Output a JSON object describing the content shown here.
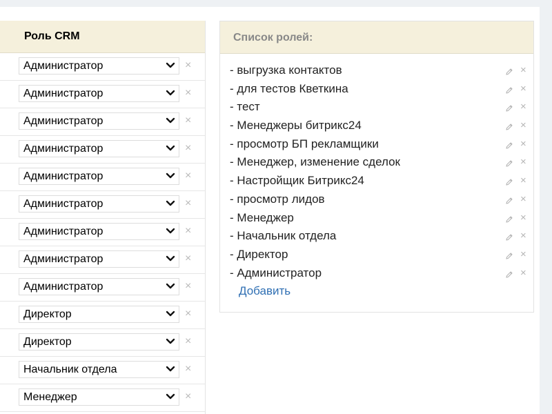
{
  "role_table": {
    "header": "Роль CRM",
    "rows": [
      {
        "role": "Администратор"
      },
      {
        "role": "Администратор"
      },
      {
        "role": "Администратор"
      },
      {
        "role": "Администратор"
      },
      {
        "role": "Администратор"
      },
      {
        "role": "Администратор"
      },
      {
        "role": "Администратор"
      },
      {
        "role": "Администратор"
      },
      {
        "role": "Администратор"
      },
      {
        "role": "Директор"
      },
      {
        "role": "Директор"
      },
      {
        "role": "Начальник отдела"
      },
      {
        "role": "Менеджер"
      }
    ],
    "remove_symbol": "×"
  },
  "roles_panel": {
    "title": "Список ролей:",
    "items": [
      {
        "label": "- выгрузка контактов"
      },
      {
        "label": "- для тестов Кветкина"
      },
      {
        "label": "- тест"
      },
      {
        "label": "- Менеджеры битрикс24"
      },
      {
        "label": "- просмотр БП рекламщики"
      },
      {
        "label": "- Менеджер, изменение сделок"
      },
      {
        "label": "- Настройщик Битрикс24"
      },
      {
        "label": "- просмотр лидов"
      },
      {
        "label": "- Менеджер"
      },
      {
        "label": "- Начальник отдела"
      },
      {
        "label": "- Директор"
      },
      {
        "label": "- Администратор"
      }
    ],
    "delete_symbol": "×",
    "add_label": "Добавить"
  },
  "colors": {
    "header_bg": "#f5f0dc",
    "link": "#2f6fb3",
    "muted_icon": "#b9b9b9"
  },
  "icons": {
    "select_arrow": "chevron-down-icon",
    "remove": "close-icon",
    "edit": "pencil-icon"
  }
}
